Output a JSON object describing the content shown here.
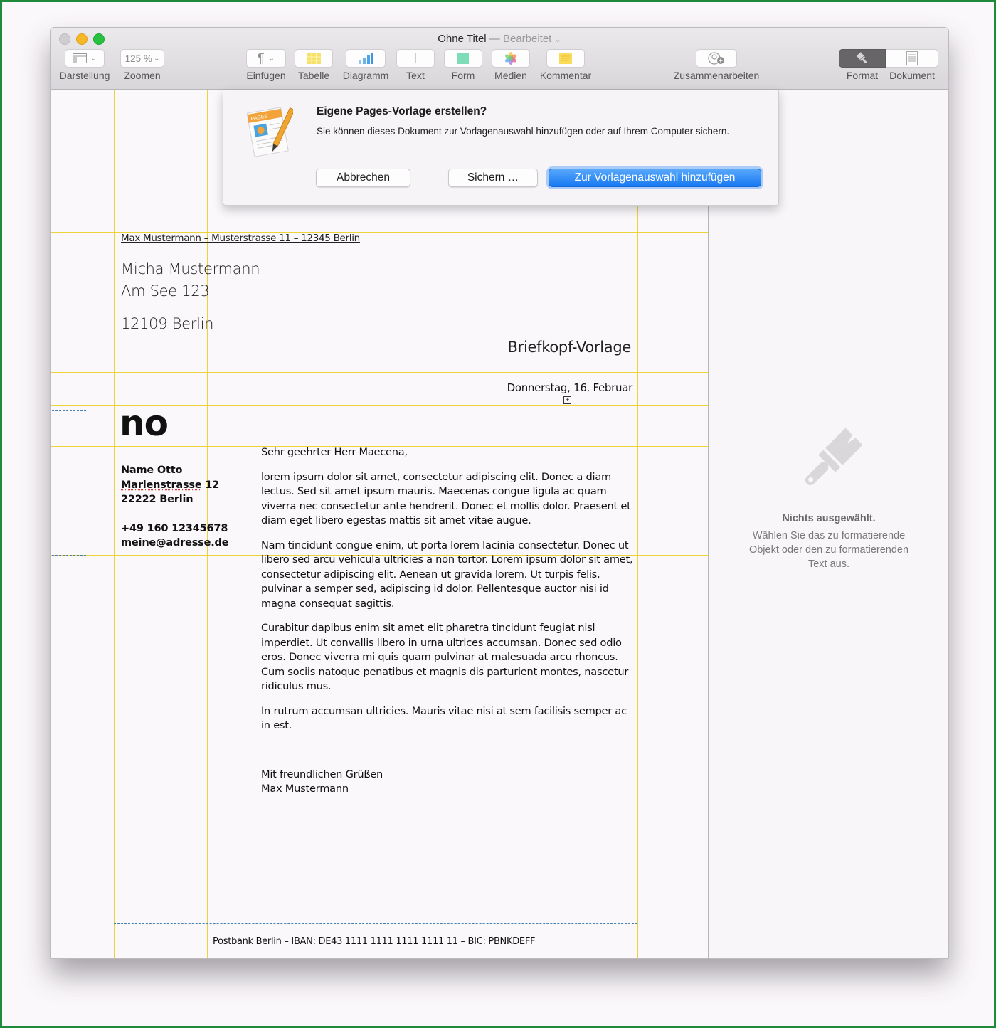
{
  "window": {
    "title": "Ohne Titel",
    "separator": "—",
    "status": "Bearbeitet"
  },
  "toolbar": {
    "view": {
      "label": "Darstellung",
      "icon": "sidebar-layout-icon"
    },
    "zoom": {
      "label": "Zoomen",
      "value": "125 %"
    },
    "insert": {
      "label": "Einfügen",
      "icon": "pilcrow-icon",
      "glyph": "¶"
    },
    "table": {
      "label": "Tabelle",
      "icon": "table-icon"
    },
    "chart": {
      "label": "Diagramm",
      "icon": "chart-icon"
    },
    "text": {
      "label": "Text",
      "icon": "text-icon",
      "glyph": "T"
    },
    "shape": {
      "label": "Form",
      "icon": "shape-icon"
    },
    "media": {
      "label": "Medien",
      "icon": "photos-icon"
    },
    "comment": {
      "label": "Kommentar",
      "icon": "comment-icon"
    },
    "collaborate": {
      "label": "Zusammenarbeiten",
      "icon": "add-person-icon"
    },
    "format": {
      "label": "Format",
      "icon": "paintbrush-icon",
      "active": true
    },
    "document": {
      "label": "Dokument",
      "icon": "document-icon"
    }
  },
  "dialog": {
    "title": "Eigene Pages-Vorlage erstellen?",
    "message": "Sie können dieses Dokument zur Vorlagenauswahl hinzufügen oder auf Ihrem Computer sichern.",
    "icon_label": "PAGES",
    "cancel_label": "Abbrechen",
    "save_label": "Sichern …",
    "primary_label": "Zur Vorlagenauswahl hinzufügen"
  },
  "document": {
    "sender_line": "Max Mustermann – Musterstrasse 11 – 12345 Berlin",
    "recipient": {
      "name": "Micha Mustermann",
      "street": "Am See 123",
      "city": "12109 Berlin"
    },
    "title": "Briefkopf-Vorlage",
    "date": "Donnerstag, 16. Februar",
    "logo": "no",
    "contact": {
      "name": "Name Otto",
      "street_word": "Marienstrasse",
      "street_num": " 12",
      "city": "22222 Berlin",
      "phone": "+49 160 12345678",
      "email": "meine@adresse.de"
    },
    "salutation": "Sehr geehrter Herr Maecena,",
    "paragraphs": [
      "lorem ipsum dolor sit amet, consectetur adipiscing elit. Donec a diam lectus. Sed sit amet ipsum mauris. Maecenas congue ligula ac quam viverra nec consectetur ante hendrerit. Donec et mollis dolor. Praesent et diam eget libero egestas mattis sit amet vitae augue.",
      "Nam tincidunt congue enim, ut porta lorem lacinia consectetur. Donec ut libero sed arcu vehicula ultricies a non tortor. Lorem ipsum dolor sit amet, consectetur adipiscing elit. Aenean ut gravida lorem. Ut turpis felis, pulvinar a semper sed, adipiscing id dolor. Pellentesque auctor nisi id magna consequat sagittis.",
      "Curabitur dapibus enim sit amet elit pharetra tincidunt feugiat nisl imperdiet. Ut convallis libero in urna ultrices accumsan. Donec sed odio eros. Donec viverra mi quis quam pulvinar at malesuada arcu rhoncus. Cum sociis natoque penatibus et magnis dis parturient montes, nascetur ridiculus mus.",
      "In rutrum accumsan ultricies. Mauris vitae nisi at sem facilisis semper ac in est."
    ],
    "closing": "Mit freundlichen Grüßen",
    "signature": "Max Mustermann",
    "footer": "Postbank Berlin – IBAN: DE43 1111 1111 1111 1111 11 – BIC: PBNKDEFF"
  },
  "sidebar": {
    "heading": "Nichts ausgewählt.",
    "message": "Wählen Sie das zu formatierende Objekt oder den zu formatierenden Text aus.",
    "icon": "paintbrush-icon"
  },
  "colors": {
    "guide": "#ecd33a",
    "primary_button": "#1778f2",
    "frame": "#1f8a3a"
  }
}
